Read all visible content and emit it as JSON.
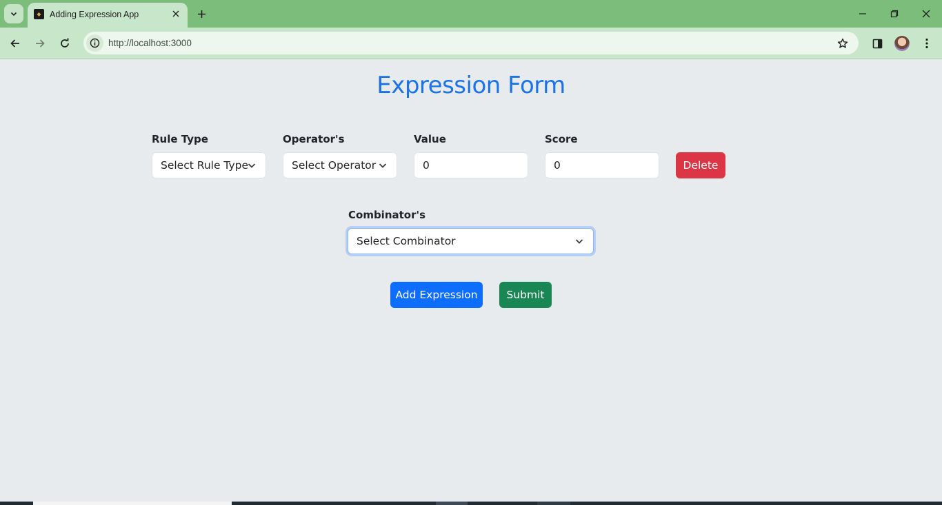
{
  "browser": {
    "tab_title": "Adding Expression App",
    "url": "http://localhost:3000"
  },
  "page": {
    "title": "Expression Form",
    "rule": {
      "rule_type_label": "Rule Type",
      "rule_type_value": "Select Rule Type",
      "operator_label": "Operator's",
      "operator_value": "Select Operator",
      "value_label": "Value",
      "value_value": "0",
      "score_label": "Score",
      "score_value": "0",
      "delete_label": "Delete"
    },
    "combinator_label": "Combinator's",
    "combinator_value": "Select Combinator",
    "add_expression_label": "Add Expression",
    "submit_label": "Submit"
  },
  "colors": {
    "title": "#1a73e8",
    "delete": "#dc3545",
    "add": "#0d6efd",
    "submit": "#198754",
    "page_bg": "#e8ebee",
    "chrome": "#7cbd7c"
  },
  "icons": [
    "tab-search-icon",
    "close-icon",
    "plus-icon",
    "minimize-icon",
    "restore-icon",
    "back-icon",
    "forward-icon",
    "reload-icon",
    "info-icon",
    "star-icon",
    "side-panel-icon",
    "menu-dots-icon",
    "chevron-down-icon"
  ]
}
